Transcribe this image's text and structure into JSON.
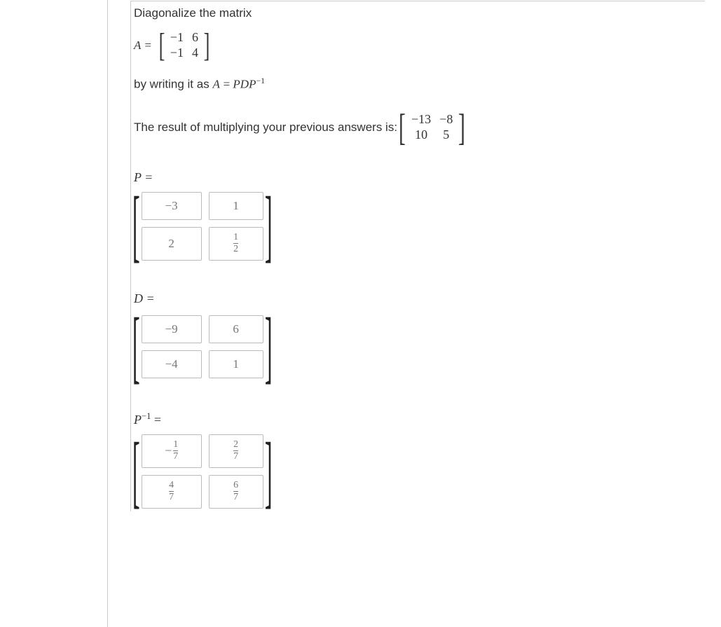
{
  "problem": {
    "intro": "Diagonalize the matrix",
    "A_label": "A =",
    "A": [
      [
        "−1",
        "6"
      ],
      [
        "−1",
        "4"
      ]
    ],
    "decomp_text_prefix": "by writing it as ",
    "decomp_eq_lhs": "A",
    "decomp_eq_eq": " = ",
    "decomp_eq_rhs": "PDP",
    "decomp_eq_sup": "−1",
    "result_text": "The result of multiplying your previous answers is: ",
    "result_matrix": [
      [
        "−13",
        "−8"
      ],
      [
        "10",
        "5"
      ]
    ]
  },
  "answers": {
    "P": {
      "label": "P =",
      "cells": [
        [
          "−3",
          "1"
        ],
        [
          "2",
          "1/2"
        ]
      ]
    },
    "D": {
      "label": "D =",
      "cells": [
        [
          "−9",
          "6"
        ],
        [
          "−4",
          "1"
        ]
      ]
    },
    "Pinv": {
      "label_base": "P",
      "label_sup": "−1",
      "label_eq": " =",
      "cells": [
        [
          "−1/7",
          "2/7"
        ],
        [
          "4/7",
          "6/7"
        ]
      ]
    }
  }
}
